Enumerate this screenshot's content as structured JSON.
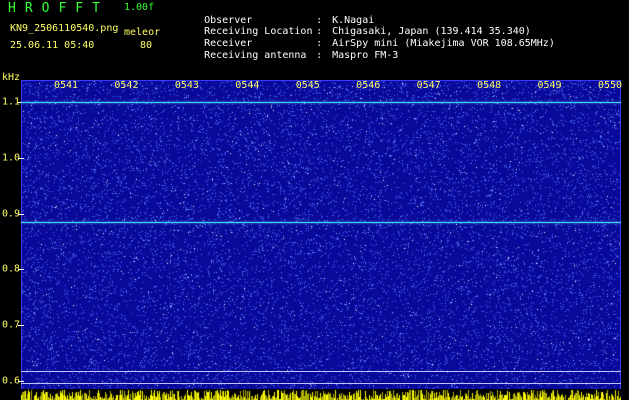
{
  "header": {
    "app_title": "HROFFT",
    "version": "1.00f",
    "file_name": "KN9_2506110540.png",
    "timestamp": "25.06.11 05:40",
    "mode_label": "meleor",
    "mode_value": "80",
    "meta": [
      {
        "key": "Observer",
        "value": "K.Nagai"
      },
      {
        "key": "Receiving Location",
        "value": "Chigasaki, Japan (139.414 35.340)"
      },
      {
        "key": "Receiver",
        "value": "AirSpy mini (Miakejima VOR 108.65MHz)"
      },
      {
        "key": "Receiving antenna",
        "value": "Maspro FM-3"
      }
    ]
  },
  "spectrogram": {
    "y_unit": "kHz",
    "x_ticks": [
      "0541",
      "0542",
      "0543",
      "0544",
      "0545",
      "0546",
      "0547",
      "0548",
      "0549",
      "0550"
    ],
    "y_ticks": [
      "1.1",
      "1.0",
      "0.9",
      "0.8",
      "0.7",
      "0.6"
    ],
    "y_range_khz": [
      0.58,
      1.14
    ],
    "carrier_lines_khz": [
      1.1,
      0.885,
      0.617,
      0.597
    ],
    "colors": {
      "background": "#0a0a9a",
      "noise_dot": "#4f6bff",
      "carrier": "#40d0ff",
      "tick_text": "#ffff66",
      "activity_bar": "#ffff00"
    }
  }
}
